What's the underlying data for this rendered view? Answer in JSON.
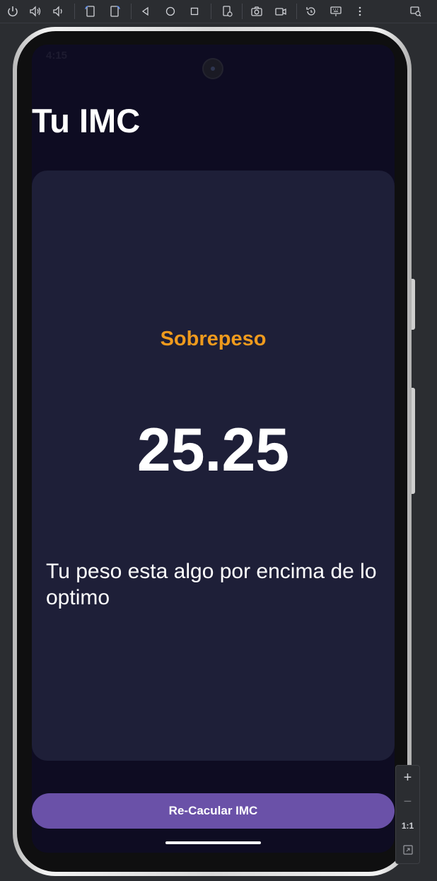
{
  "toolbar": {
    "icons": [
      "power-icon",
      "volume-up-icon",
      "volume-down-icon",
      "rotate-left-icon",
      "rotate-right-icon",
      "back-icon",
      "home-icon",
      "overview-icon",
      "device-settings-icon",
      "camera-icon",
      "screen-record-icon",
      "snapshot-icon",
      "keyboard-icon",
      "more-icon",
      "device-frame-icon"
    ]
  },
  "status": {
    "time": "4:15"
  },
  "app": {
    "title": "Tu IMC",
    "category": "Sobrepeso",
    "category_color": "#ef9a1d",
    "imc_value": "25.25",
    "description": "Tu peso esta algo por encima de lo optimo",
    "button_label": "Re-Cacular IMC",
    "button_color": "#6a51a8"
  },
  "zoom": {
    "zoom_in": "+",
    "zoom_out": "−",
    "actual_size": "1:1"
  }
}
